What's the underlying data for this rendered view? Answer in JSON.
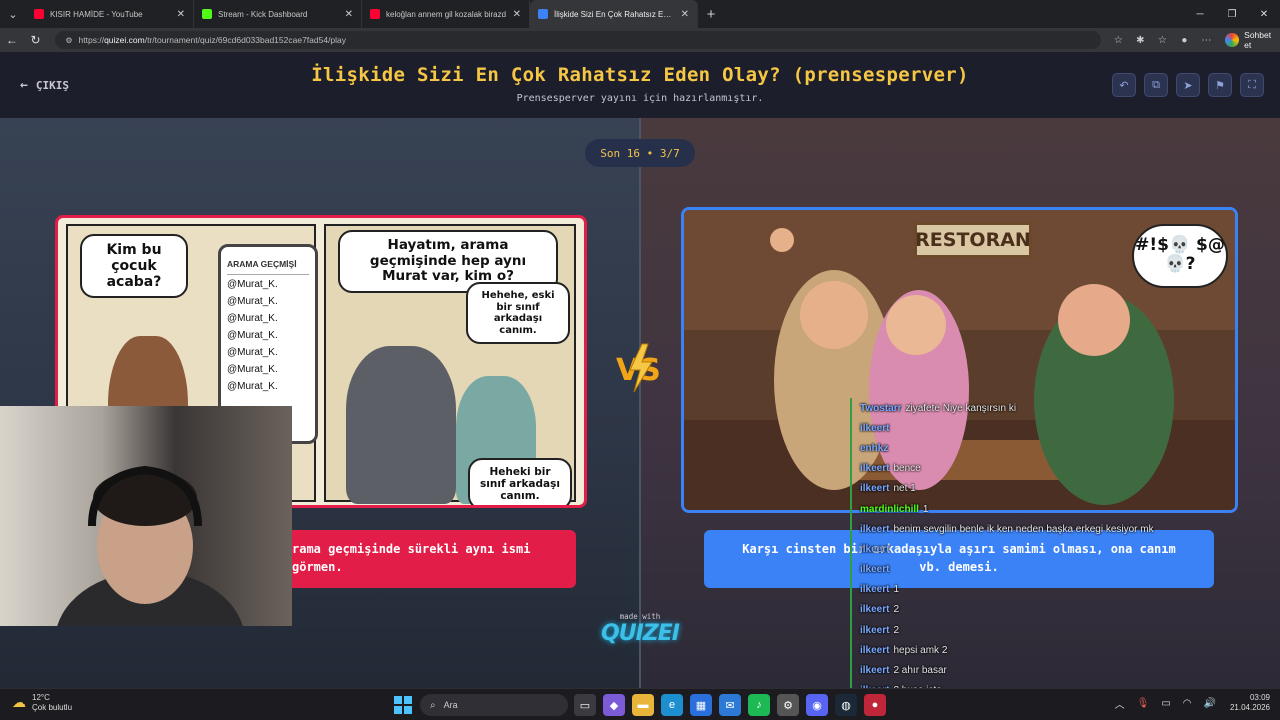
{
  "browser": {
    "tabs": [
      {
        "label": "KISIR HAMİDE - YouTube",
        "color": "#ff0033",
        "active": false
      },
      {
        "label": "Stream - Kick Dashboard",
        "color": "#53fc18",
        "active": false
      },
      {
        "label": "keloğlan annem gil kozalak birazd",
        "color": "#ff0033",
        "active": false
      },
      {
        "label": "İlişkide Sizi En Çok Rahatsız Eden O",
        "color": "#3b82f6",
        "active": true
      }
    ],
    "url_prefix": "https://",
    "url_domain": "quizei.com",
    "url_path": "/tr/tournament/quiz/69cd6d033bad152cae7fad54/play",
    "chat_button": "Sohbet et"
  },
  "header": {
    "exit_label": "ÇIKIŞ",
    "title": "İlişkide Sizi En Çok Rahatsız Eden Olay? (prensesperver)",
    "subtitle": "Prensesperver yayını için hazırlanmıştır."
  },
  "round": {
    "label": "Son 16 • 3/7"
  },
  "left_card": {
    "bubble1": "Kim bu çocuk acaba?",
    "phone_title": "ARAMA GEÇMİŞİ",
    "phone_items": [
      "@Murat_K.",
      "@Murat_K.",
      "@Murat_K.",
      "@Murat_K.",
      "@Murat_K.",
      "@Murat_K.",
      "@Murat_K."
    ],
    "bubble2": "Hayatım, arama geçmişinde hep aynı Murat var, kim o?",
    "bubble3": "Hehehe, eski bir sınıf arkadaşı canım.",
    "bubble4": "Heheki bir sınıf arkadaşı canım."
  },
  "right_card": {
    "sign": "RESTORAN",
    "curse": "#!$💀 $@💀?"
  },
  "answers": {
    "left": "rama geçmişinde sürekli aynı ismi görmen.",
    "right": "Karşı cinsten bir arkadaşıyla aşırı samimi olması, ona canım vb. demesi."
  },
  "branding": {
    "made_with": "made with",
    "logo": "QUIZEI"
  },
  "chat": [
    {
      "user": "Twostarr",
      "text": "ziyafete Niye kanşırsın ki",
      "green": false
    },
    {
      "user": "ilkeert",
      "text": "",
      "green": false
    },
    {
      "user": "enhkz",
      "text": "",
      "green": false
    },
    {
      "user": "ilkeert",
      "text": "bence",
      "green": false
    },
    {
      "user": "ilkeert",
      "text": "net 1",
      "green": false
    },
    {
      "user": "mardinlichill",
      "text": "1",
      "green": true
    },
    {
      "user": "ilkeert",
      "text": "benim sevgilin benle ik ken neden başka erkegi kesiyor mk",
      "green": false
    },
    {
      "user": "ilkeert",
      "text": "",
      "green": false
    },
    {
      "user": "ilkeert",
      "text": "",
      "green": false
    },
    {
      "user": "ilkeert",
      "text": "1",
      "green": false
    },
    {
      "user": "ilkeert",
      "text": "2",
      "green": false
    },
    {
      "user": "ilkeert",
      "text": "2",
      "green": false
    },
    {
      "user": "ilkeert",
      "text": "hepsi amk 2",
      "green": false
    },
    {
      "user": "ilkeert",
      "text": "2 ahır basar",
      "green": false
    },
    {
      "user": "ilkeert",
      "text": "2 buse işte",
      "green": false
    },
    {
      "user": "ilkeert",
      "text": "1",
      "green": false
    }
  ],
  "taskbar": {
    "temp": "12°C",
    "weather": "Çok bulutlu",
    "search": "Ara",
    "time": "03:09",
    "date": "21.04.2026"
  }
}
